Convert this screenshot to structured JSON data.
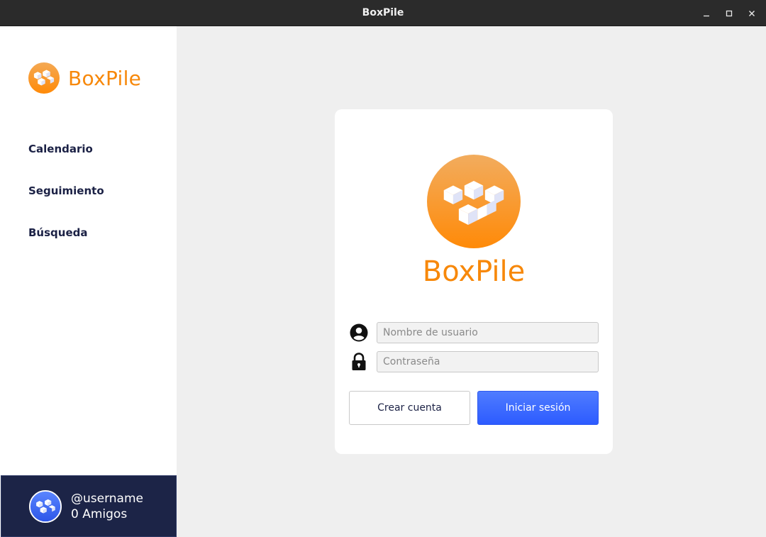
{
  "window": {
    "title": "BoxPile"
  },
  "sidebar": {
    "brand": "BoxPile",
    "nav": [
      {
        "label": "Calendario"
      },
      {
        "label": "Seguimiento"
      },
      {
        "label": "Búsqueda"
      }
    ],
    "user": {
      "username": "@username",
      "friends": "0 Amigos"
    }
  },
  "login": {
    "brand": "BoxPile",
    "username_placeholder": "Nombre de usuario",
    "password_placeholder": "Contraseña",
    "create_label": "Crear cuenta",
    "login_label": "Iniciar sesión"
  },
  "colors": {
    "brand_orange": "#f7880a",
    "navy": "#1c2447",
    "primary_blue": "#2d5bff"
  },
  "icons": [
    "boxpile-logo-icon",
    "user-circle-icon",
    "lock-icon",
    "minimize-icon",
    "maximize-icon",
    "close-icon"
  ]
}
